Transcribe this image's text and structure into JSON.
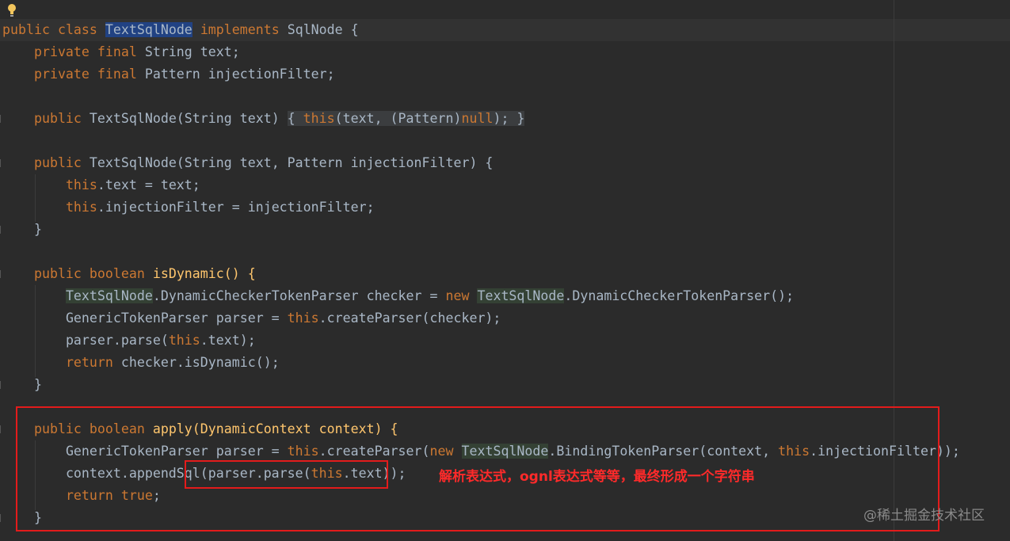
{
  "code": {
    "l1": {
      "public": "public",
      "class": "class",
      "cls": "TextSqlNode",
      "implements": "implements",
      "rest": " SqlNode {"
    },
    "l2": {
      "private": "private",
      "final": "final",
      "rest": " String text;"
    },
    "l3": {
      "private": "private",
      "final": "final",
      "rest": " Pattern injectionFilter;"
    },
    "l5": {
      "public": "public",
      "sig": " TextSqlNode(String text) ",
      "open": "{ ",
      "this": "this",
      "mid": "(text, (Pattern)",
      "null": "null",
      "end": "); ",
      "close": "}"
    },
    "l7": {
      "public": "public",
      "rest": " TextSqlNode(String text, Pattern injectionFilter) {"
    },
    "l8": {
      "this": "this",
      "rest": ".text = text;"
    },
    "l9": {
      "this": "this",
      "rest": ".injectionFilter = injectionFilter;"
    },
    "l10": {
      "rest": "}"
    },
    "l12": {
      "public": "public",
      "boolean": "boolean",
      "rest": " isDynamic() {"
    },
    "l13": {
      "cls1": "TextSqlNode",
      "mid": ".DynamicCheckerTokenParser checker = ",
      "new": "new",
      "cls2": "TextSqlNode",
      "end": ".DynamicCheckerTokenParser();"
    },
    "l14": {
      "pre": "GenericTokenParser parser = ",
      "this": "this",
      "end": ".createParser(checker);"
    },
    "l15": {
      "pre": "parser.parse(",
      "this": "this",
      "end": ".text);"
    },
    "l16": {
      "return": "return",
      "rest": " checker.isDynamic();"
    },
    "l17": {
      "rest": "}"
    },
    "l19": {
      "public": "public",
      "boolean": "boolean",
      "rest": " apply(DynamicContext context) {"
    },
    "l20": {
      "pre": "GenericTokenParser parser = ",
      "this1": "this",
      "mid1": ".createParser(",
      "new": "new",
      "cls": "TextSqlNode",
      "mid2": ".BindingTokenParser(context, ",
      "this2": "this",
      "end": ".injectionFilter));"
    },
    "l21": {
      "pre": "context.appendSql(parser.parse(",
      "this": "this",
      "end": ".text));"
    },
    "l22": {
      "return": "return",
      "true": "true",
      "end": ";"
    },
    "l23": {
      "rest": "}"
    }
  },
  "annotation": "解析表达式，ognl表达式等等，最终形成一个字符串",
  "watermark": "@稀土掘金技术社区",
  "icons": {
    "intention": "lightbulb-icon"
  },
  "colors": {
    "keyword": "#cc7832",
    "text": "#a9b7c6",
    "background": "#2b2b2b",
    "highlight_box": "#e31b1b"
  }
}
